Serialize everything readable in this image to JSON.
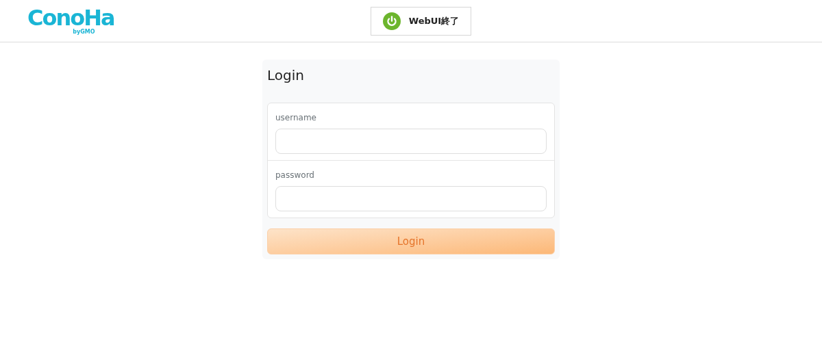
{
  "header": {
    "logo": {
      "name": "ConoHa",
      "byline": "byGMO"
    },
    "shutdown_button": {
      "label": "WebUI終了"
    }
  },
  "login_card": {
    "title": "Login",
    "fields": [
      {
        "label": "username"
      },
      {
        "label": "password"
      }
    ],
    "submit_button": {
      "label": "Login"
    }
  }
}
